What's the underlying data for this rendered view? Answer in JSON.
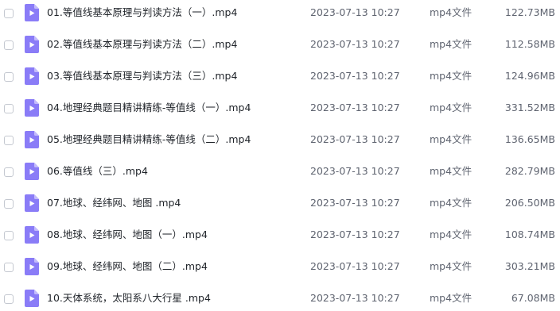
{
  "colors": {
    "video_icon": "#8a7cf7",
    "video_icon_fold": "#c3bbfb",
    "play_glyph": "#ffffff"
  },
  "files": [
    {
      "name": "01.等值线基本原理与判读方法（一）.mp4",
      "date": "2023-07-13 10:27",
      "type": "mp4文件",
      "size": "122.73MB",
      "icon": "video-file-icon"
    },
    {
      "name": "02.等值线基本原理与判读方法（二）.mp4",
      "date": "2023-07-13 10:27",
      "type": "mp4文件",
      "size": "112.58MB",
      "icon": "video-file-icon"
    },
    {
      "name": "03.等值线基本原理与判读方法（三）.mp4",
      "date": "2023-07-13 10:27",
      "type": "mp4文件",
      "size": "124.96MB",
      "icon": "video-file-icon"
    },
    {
      "name": "04.地理经典题目精讲精练-等值线（一）.mp4",
      "date": "2023-07-13 10:27",
      "type": "mp4文件",
      "size": "331.52MB",
      "icon": "video-file-icon"
    },
    {
      "name": "05.地理经典题目精讲精练-等值线（二）.mp4",
      "date": "2023-07-13 10:27",
      "type": "mp4文件",
      "size": "136.65MB",
      "icon": "video-file-icon"
    },
    {
      "name": "06.等值线（三）.mp4",
      "date": "2023-07-13 10:27",
      "type": "mp4文件",
      "size": "282.79MB",
      "icon": "video-file-icon"
    },
    {
      "name": "07.地球、经纬网、地图 .mp4",
      "date": "2023-07-13 10:27",
      "type": "mp4文件",
      "size": "206.50MB",
      "icon": "video-file-icon"
    },
    {
      "name": "08.地球、经纬网、地图（一）.mp4",
      "date": "2023-07-13 10:27",
      "type": "mp4文件",
      "size": "108.74MB",
      "icon": "video-file-icon"
    },
    {
      "name": "09.地球、经纬网、地图（二）.mp4",
      "date": "2023-07-13 10:27",
      "type": "mp4文件",
      "size": "303.21MB",
      "icon": "video-file-icon"
    },
    {
      "name": "10.天体系统，太阳系八大行星 .mp4",
      "date": "2023-07-13 10:27",
      "type": "mp4文件",
      "size": "67.08MB",
      "icon": "video-file-icon"
    }
  ]
}
